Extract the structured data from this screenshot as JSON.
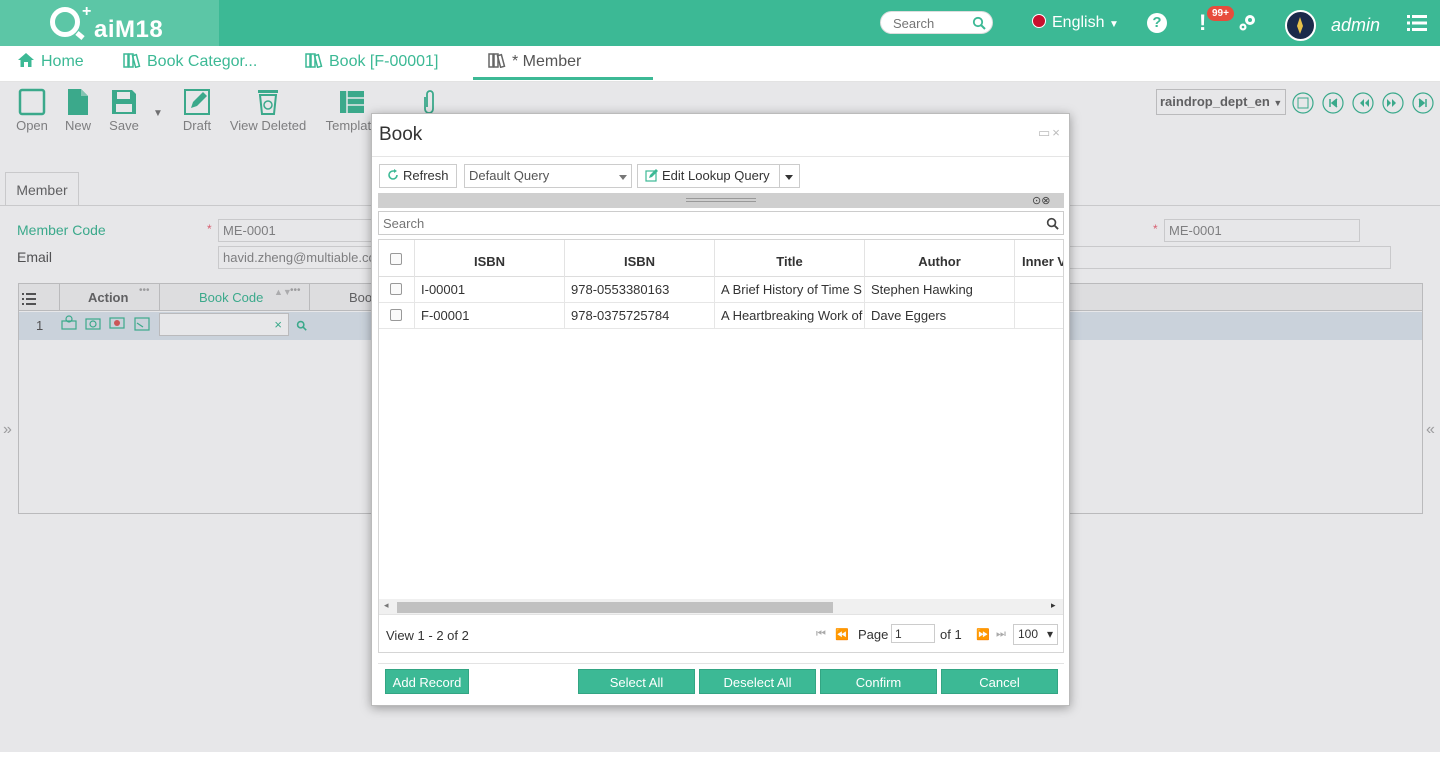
{
  "app": {
    "logo_text": "aiM18",
    "logo_spark": "+",
    "search_placeholder": "Search",
    "language": "English",
    "help_glyph": "?",
    "alert_glyph": "!",
    "alert_badge": "99+",
    "username": "admin"
  },
  "tabs": [
    {
      "label": "Home"
    },
    {
      "label": "Book Categor..."
    },
    {
      "label": "Book [F-00001]"
    },
    {
      "label": "* Member"
    }
  ],
  "toolbar": {
    "open": "Open",
    "new": "New",
    "save": "Save",
    "draft": "Draft",
    "view_deleted": "View Deleted",
    "template": "Template",
    "dept_select": "raindrop_dept_en"
  },
  "form": {
    "tab_label": "Member",
    "member_code_label": "Member Code",
    "member_code_value": "ME-0001",
    "member_code_value_right": "ME-0001",
    "email_label": "Email",
    "email_value": "havid.zheng@multiable.com",
    "required_mark": "*"
  },
  "grid": {
    "col_action": "Action",
    "col_book_code": "Book Code",
    "col_book": "Boo",
    "row_number": "1",
    "clear_glyph": "×"
  },
  "dialog": {
    "title": "Book",
    "controls": "▭×",
    "refresh": "Refresh",
    "query": "Default Query",
    "edit_query": "Edit Lookup Query",
    "search_placeholder": "Search",
    "columns": [
      "ISBN",
      "ISBN",
      "Title",
      "Author",
      "Inner V"
    ],
    "rows": [
      {
        "code": "I-00001",
        "isbn": "978-0553380163",
        "title": "A Brief History of Time S",
        "author": "Stephen Hawking"
      },
      {
        "code": "F-00001",
        "isbn": "978-0375725784",
        "title": "A Heartbreaking Work of",
        "author": "Dave Eggers"
      }
    ],
    "view_text": "View 1 - 2 of 2",
    "page_label": "Page",
    "page_value": "1",
    "page_of": "of 1",
    "page_size": "100",
    "add_record": "Add Record",
    "select_all": "Select All",
    "deselect_all": "Deselect All",
    "confirm": "Confirm",
    "cancel": "Cancel"
  },
  "colors": {
    "brand": "#3cb995",
    "brand_light": "#5cc6a6",
    "badge": "#e74c3c"
  }
}
